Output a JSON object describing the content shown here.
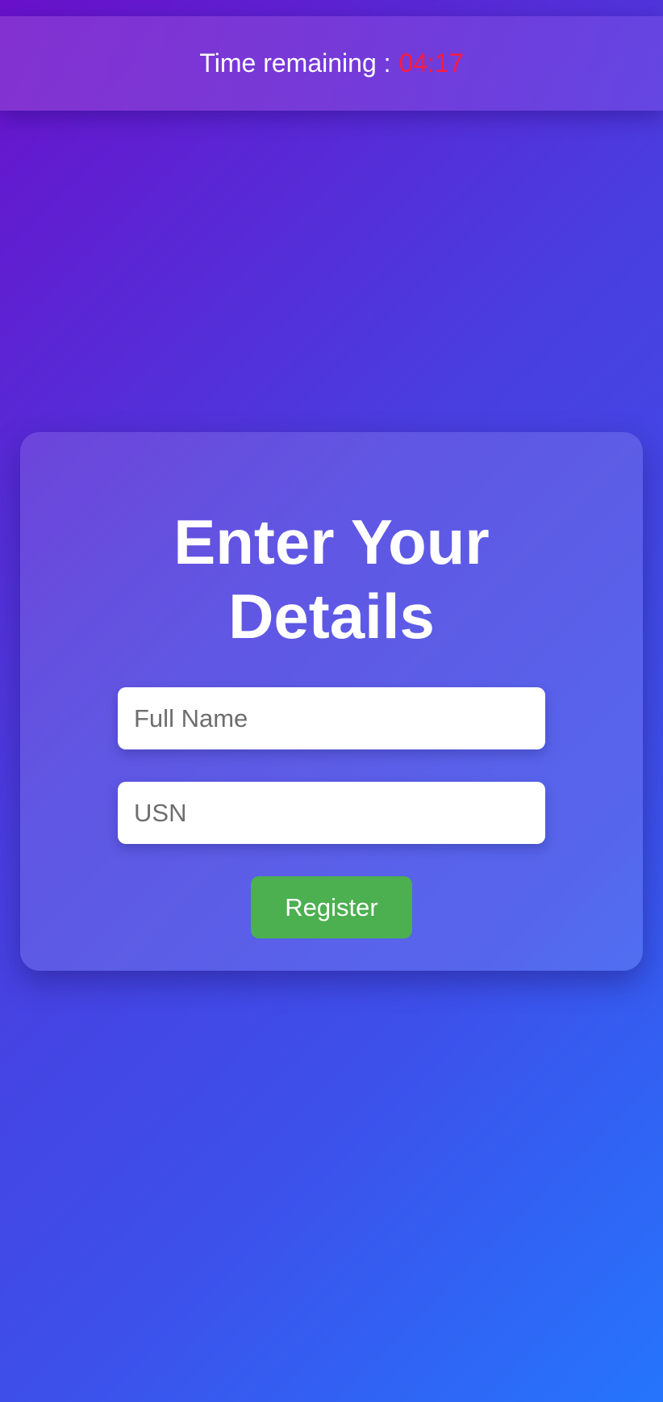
{
  "timer": {
    "label": "Time remaining :",
    "value": "04:17",
    "value_color": "#ff1a3c"
  },
  "form": {
    "title": "Enter Your Details",
    "name_placeholder": "Full Name",
    "usn_placeholder": "USN",
    "register_label": "Register",
    "register_color": "#4caf50"
  },
  "background": {
    "gradient_start": "#6a11cb",
    "gradient_end": "#2575fc"
  }
}
